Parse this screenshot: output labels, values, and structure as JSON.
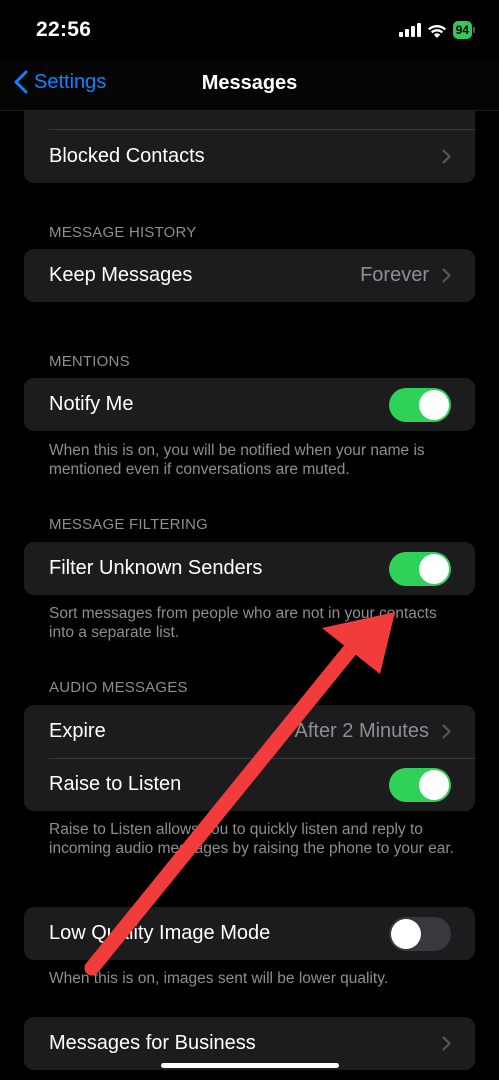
{
  "status": {
    "time": "22:56",
    "battery": "94"
  },
  "nav": {
    "back_label": "Settings",
    "title": "Messages"
  },
  "blocked": {
    "label": "Blocked Contacts"
  },
  "history": {
    "header": "MESSAGE HISTORY",
    "keep_label": "Keep Messages",
    "keep_value": "Forever"
  },
  "mentions": {
    "header": "MENTIONS",
    "notify_label": "Notify Me",
    "notify_on": true,
    "footer": "When this is on, you will be notified when your name is mentioned even if conversations are muted."
  },
  "filtering": {
    "header": "MESSAGE FILTERING",
    "filter_label": "Filter Unknown Senders",
    "filter_on": true,
    "footer": "Sort messages from people who are not in your contacts into a separate list."
  },
  "audio": {
    "header": "AUDIO MESSAGES",
    "expire_label": "Expire",
    "expire_value": "After 2 Minutes",
    "raise_label": "Raise to Listen",
    "raise_on": true,
    "footer": "Raise to Listen allows you to quickly listen and reply to incoming audio messages by raising the phone to your ear."
  },
  "low_quality": {
    "label": "Low Quality Image Mode",
    "on": false,
    "footer": "When this is on, images sent will be lower quality."
  },
  "business": {
    "label": "Messages for Business"
  },
  "colors": {
    "accent": "#0a84ff",
    "toggle_on": "#30d158",
    "annotation_arrow": "#f23c3c"
  }
}
